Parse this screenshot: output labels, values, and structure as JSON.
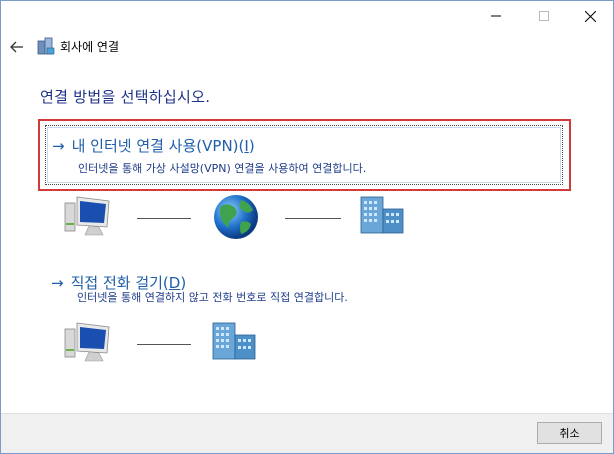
{
  "window": {
    "title": "회사에 연결",
    "controls": [
      "minimize-icon",
      "maximize-icon",
      "close-icon"
    ]
  },
  "heading": "연결 방법을 선택하십시오.",
  "options": [
    {
      "title_prefix": "내 인터넷 연결 사용(VPN)(",
      "accel": "I",
      "title_suffix": ")",
      "description": "인터넷을 통해 가상 사설망(VPN) 연결을 사용하여 연결합니다.",
      "icon": "arrow-right-icon",
      "selected": true
    },
    {
      "title_prefix": "직접 전화 걸기(",
      "accel": "D",
      "title_suffix": ")",
      "description": "인터넷을 통해 연결하지 않고 전화 번호로 직접 연결합니다.",
      "icon": "arrow-right-icon",
      "selected": false
    }
  ],
  "footer": {
    "cancel_label": "취소"
  },
  "colors": {
    "heading": "#1e3287",
    "link": "#1f5fa8",
    "highlight_border": "#d23a3a"
  }
}
